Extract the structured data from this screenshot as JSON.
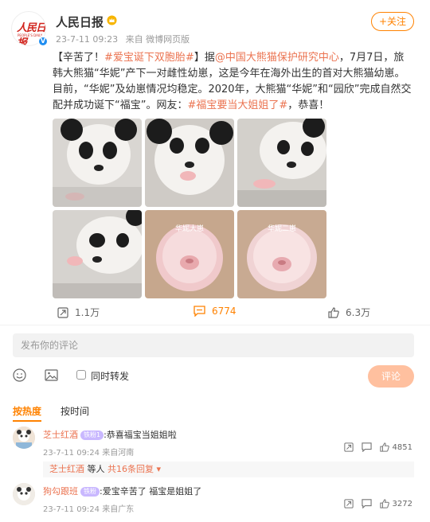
{
  "post": {
    "author": "人民日报",
    "avatar_text": "人民日报",
    "avatar_sub": "PEOPLE'S DAILY",
    "time": "23-7-11 09:23",
    "source": "来自 微博网页版",
    "follow_label": "+关注",
    "text": {
      "tag1": "#爱宝诞下双胞胎#",
      "t1": "【辛苦了！",
      "t2": "】据",
      "mention": "@中国大熊猫保护研究中心",
      "t3": "，7月7日，旅韩大熊猫“华妮”产下一对雌性幼崽，这是今年在海外出生的首对大熊猫幼崽。目前，“华妮”及幼崽情况均稳定。2020年，大熊猫“华妮”和“园欣”完成自然交配并成功诞下“福宝”。网友：",
      "tag2": "#福宝要当大姐姐了#",
      "t4": "，恭喜！"
    },
    "photo_captions": [
      "华妮大崽",
      "华妮二崽"
    ]
  },
  "actions": {
    "forward": "1.1万",
    "comment": "6774",
    "like": "6.3万"
  },
  "composer": {
    "placeholder": "发布你的评论",
    "forward_check_label": "同时转发",
    "submit_label": "评论"
  },
  "sort": {
    "hot": "按热度",
    "time": "按时间"
  },
  "comments": [
    {
      "name": "芝士红酒",
      "badge": "铁粉1",
      "text": ":恭喜福宝当姐姐啦",
      "time": "23-7-11 09:24",
      "location": "来自河南",
      "likes": "4851",
      "reply_name": "芝士红酒",
      "reply_text": " 等人 ",
      "reply_more": "共16条回复"
    },
    {
      "name": "狗勾跟班",
      "badge": "铁粉",
      "text": ":爱宝辛苦了 福宝是姐姐了",
      "time": "23-7-11 09:24",
      "location": "来自广东",
      "likes": "3272"
    }
  ],
  "colors": {
    "accent": "#ff8200",
    "link": "#eb7350",
    "brand_red": "#d1231c"
  }
}
